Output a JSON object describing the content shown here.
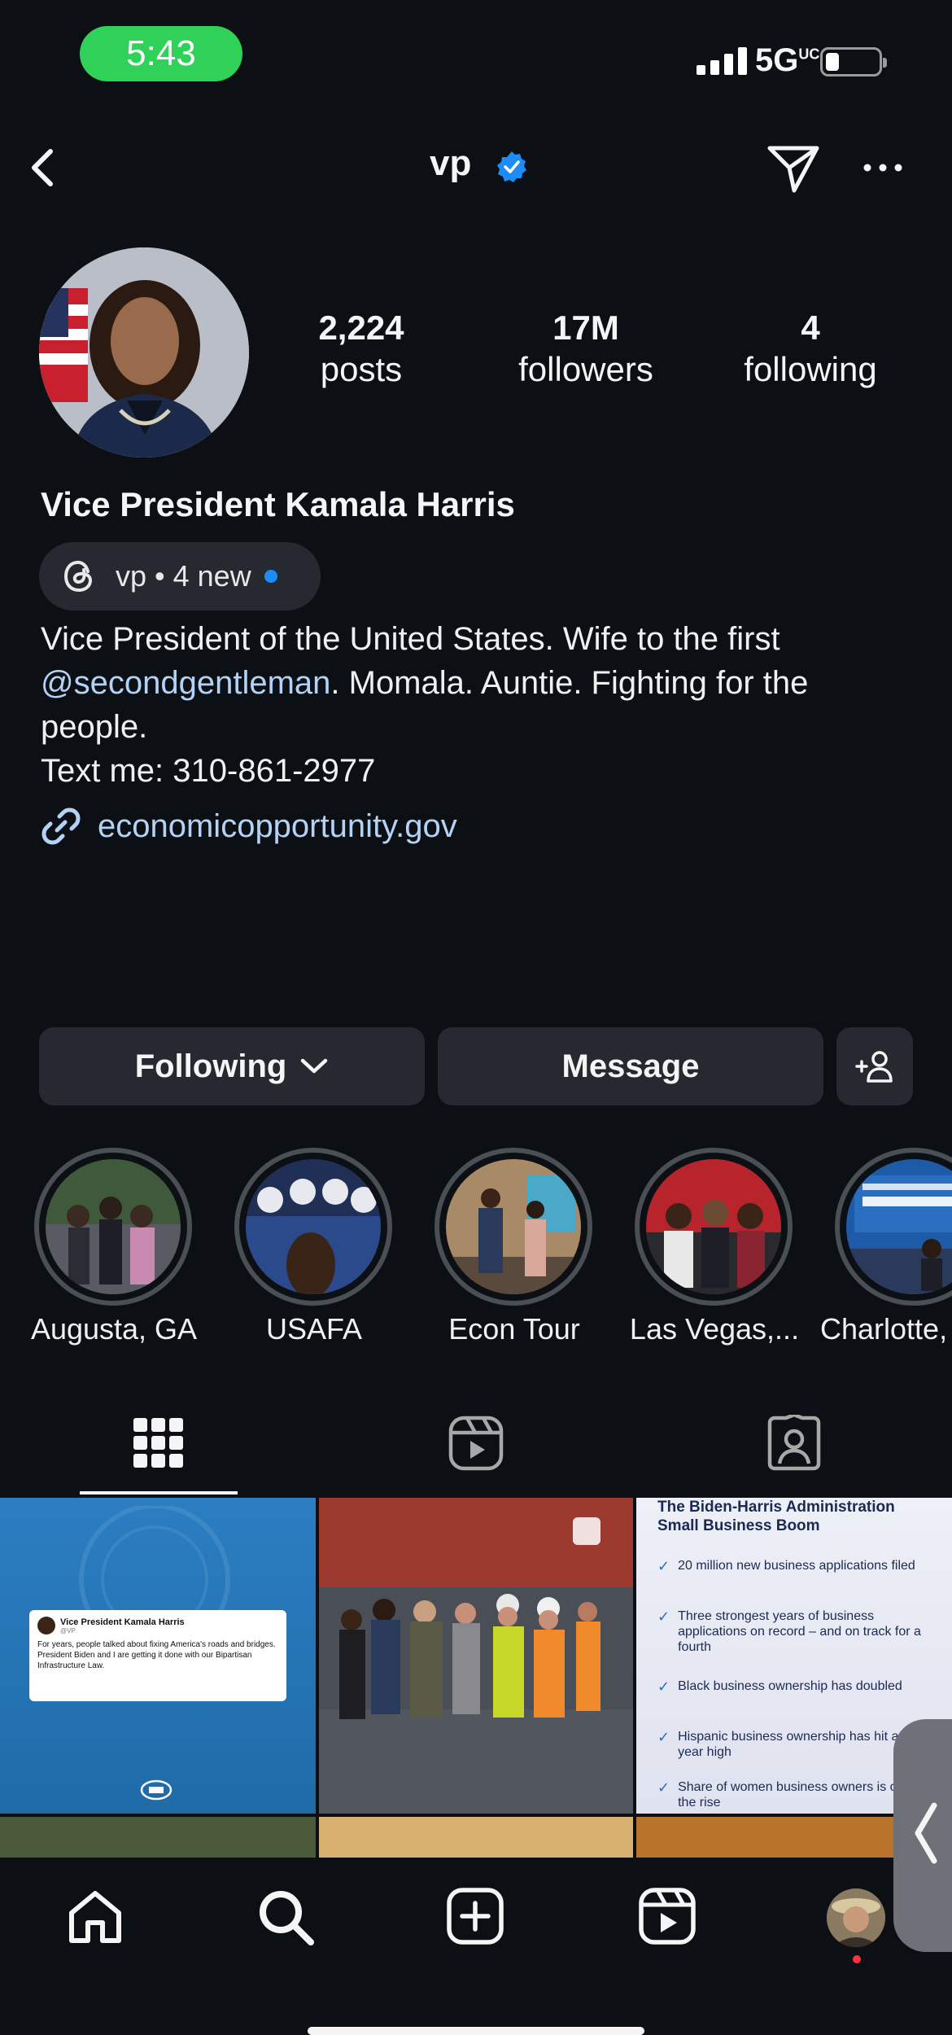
{
  "status_bar": {
    "time": "5:43",
    "network": "5G",
    "network_sup": "UC"
  },
  "header": {
    "username": "vp"
  },
  "profile": {
    "stats": [
      {
        "value": "2,224",
        "label": "posts"
      },
      {
        "value": "17M",
        "label": "followers"
      },
      {
        "value": "4",
        "label": "following"
      }
    ],
    "display_name": "Vice President Kamala Harris",
    "threads_badge": "vp • 4 new",
    "bio_line1": "Vice President of the United States. Wife to the first",
    "bio_mention": "@secondgentleman",
    "bio_line2_rest": ". Momala. Auntie. Fighting for the",
    "bio_line3": "people.",
    "bio_line4": "Text me: 310-861-2977",
    "link": "economicopportunity.gov"
  },
  "actions": {
    "following": "Following",
    "message": "Message"
  },
  "highlights": [
    {
      "label": "Augusta, GA"
    },
    {
      "label": "USAFA"
    },
    {
      "label": "Econ Tour"
    },
    {
      "label": "Las Vegas,..."
    },
    {
      "label": "Charlotte,"
    }
  ],
  "posts": {
    "tweet_card": {
      "name": "Vice President Kamala Harris",
      "handle": "@VP",
      "text": "For years, people talked about fixing America's roads and bridges. President Biden and I are getting it done with our Bipartisan Infrastructure Law."
    },
    "infographic": {
      "title": "The Biden-Harris Administration Small Business Boom",
      "items": [
        "20 million new business applications filed",
        "Three strongest years of business applications on record – and on track for a fourth",
        "Black business ownership has doubled",
        "Hispanic business ownership has hit a 30-year high",
        "Share of women business owners is on the rise"
      ]
    }
  },
  "colors": {
    "background": "#0c1014",
    "button": "#262a30",
    "link": "#b4d2f5",
    "verified": "#1d8cf8",
    "status_pill": "#2fd158"
  }
}
